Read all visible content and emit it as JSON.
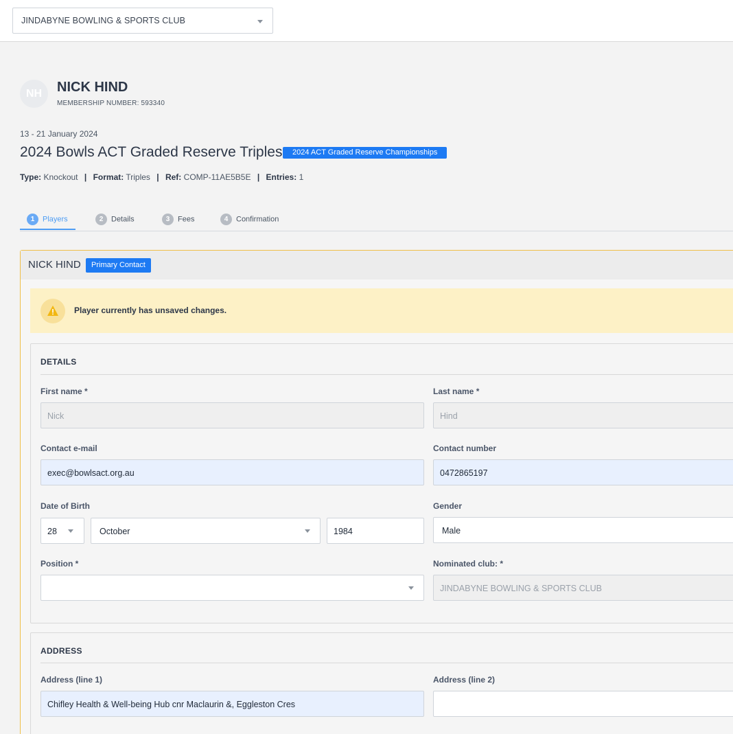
{
  "topbar": {
    "club_select": "JINDABYNE BOWLING & SPORTS CLUB"
  },
  "member": {
    "initials": "NH",
    "name": "NICK HIND",
    "membership_number": "MEMBERSHIP NUMBER: 593340"
  },
  "competition": {
    "dates": "13 - 21 January 2024",
    "title": "2024 Bowls ACT Graded Reserve Triples",
    "badge": "2024 ACT Graded Reserve Championships",
    "type_label": "Type:",
    "type_value": "Knockout",
    "format_label": "Format:",
    "format_value": "Triples",
    "ref_label": "Ref:",
    "ref_value": "COMP-11AE5B5E",
    "entries_label": "Entries:",
    "entries_value": "1",
    "separator": "|"
  },
  "tabs": [
    {
      "num": "1",
      "label": "Players",
      "active": true
    },
    {
      "num": "2",
      "label": "Details"
    },
    {
      "num": "3",
      "label": "Fees"
    },
    {
      "num": "4",
      "label": "Confirmation"
    }
  ],
  "player_card": {
    "name": "NICK HIND",
    "badge": "Primary Contact",
    "alert": "Player currently has unsaved changes."
  },
  "details": {
    "title": "DETAILS",
    "first_name_label": "First name *",
    "first_name": "Nick",
    "last_name_label": "Last name *",
    "last_name": "Hind",
    "email_label": "Contact e-mail",
    "email": "exec@bowlsact.org.au",
    "phone_label": "Contact number",
    "phone": "0472865197",
    "dob_label": "Date of Birth",
    "dob_day": "28",
    "dob_month": "October",
    "dob_year": "1984",
    "gender_label": "Gender",
    "gender": "Male",
    "position_label": "Position *",
    "position": "",
    "club_label": "Nominated club: *",
    "club": "JINDABYNE BOWLING & SPORTS CLUB"
  },
  "address": {
    "title": "ADDRESS",
    "line1_label": "Address (line 1)",
    "line1": "Chifley Health & Well-being Hub cnr Maclaurin &, Eggleston Cres",
    "line2_label": "Address (line 2)",
    "line2": ""
  },
  "colors": {
    "accent": "#1d7af3",
    "tab_active": "#4d9cf3",
    "warning_border": "#efbf47",
    "alert_bg": "#fdf1c6"
  }
}
